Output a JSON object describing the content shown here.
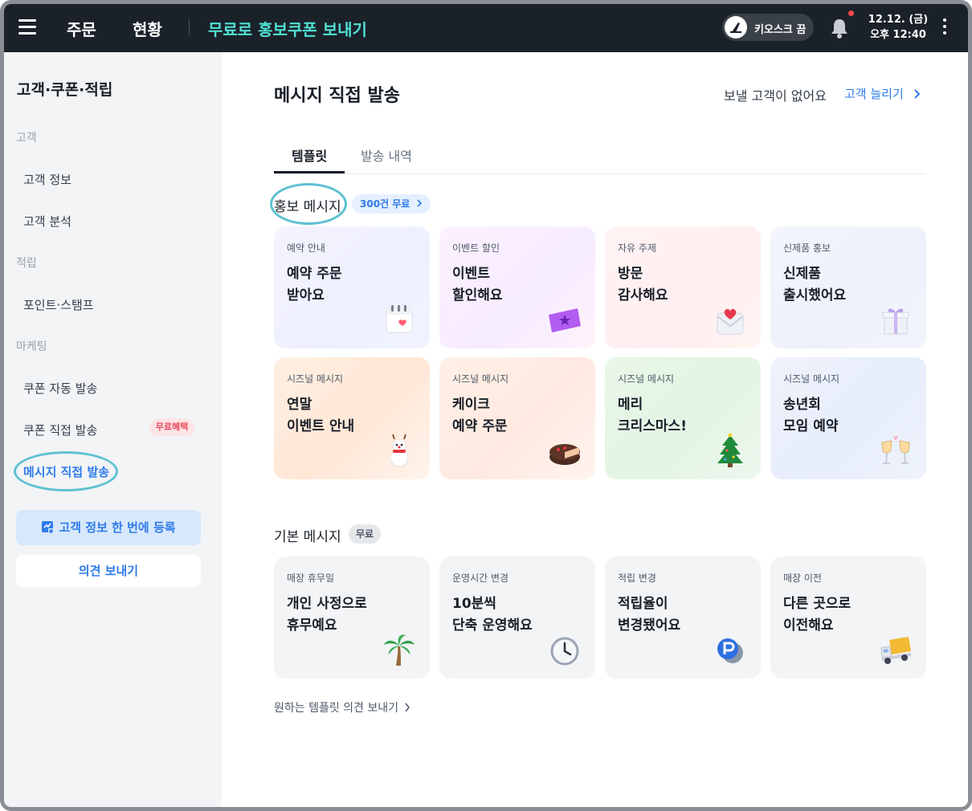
{
  "topbar": {
    "nav": [
      "주문",
      "현황"
    ],
    "promo_link": "무료로 홍보쿠폰 보내기",
    "kiosk_label": "키오스크 끔",
    "date": "12.12. (금)",
    "time": "오후 12:40",
    "accent_color": "#4fe0d4"
  },
  "sidebar": {
    "title": "고객·쿠폰·적립",
    "sections": [
      {
        "label": "고객",
        "items": [
          "고객 정보",
          "고객 분석"
        ]
      },
      {
        "label": "적립",
        "items": [
          "포인트·스탬프"
        ]
      },
      {
        "label": "마케팅",
        "items": [
          "쿠폰 자동 발송",
          "쿠폰 직접 발송",
          "메시지 직접 발송"
        ]
      }
    ],
    "coupon_badge": "무료혜택",
    "active_item": "메시지 직접 발송",
    "register_button": "고객 정보 한 번에 등록",
    "feedback_button": "의견 보내기"
  },
  "main": {
    "title": "메시지 직접 발송",
    "no_customer_text": "보낼 고객이 없어요",
    "grow_link": "고객 늘리기",
    "tabs": [
      "템플릿",
      "발송 내역"
    ],
    "promo_section": {
      "title": "홍보 메시지",
      "chip": "300건 무료",
      "cards": [
        {
          "category": "예약 안내",
          "line1": "예약 주문",
          "line2": "받아요",
          "icon": "calendar-heart-icon"
        },
        {
          "category": "이벤트 할인",
          "line1": "이벤트",
          "line2": "할인해요",
          "icon": "ticket-icon"
        },
        {
          "category": "자유 주제",
          "line1": "방문",
          "line2": "감사해요",
          "icon": "love-letter-icon"
        },
        {
          "category": "신제품 홍보",
          "line1": "신제품",
          "line2": "출시했어요",
          "icon": "gift-box-icon"
        },
        {
          "category": "시즈널 메시지",
          "line1": "연말",
          "line2": "이벤트 안내",
          "icon": "snowman-icon"
        },
        {
          "category": "시즈널 메시지",
          "line1": "케이크",
          "line2": "예약 주문",
          "icon": "cake-icon"
        },
        {
          "category": "시즈널 메시지",
          "line1": "메리",
          "line2": "크리스마스!",
          "icon": "christmas-tree-icon"
        },
        {
          "category": "시즈널 메시지",
          "line1": "송년회",
          "line2": "모임 예약",
          "icon": "champagne-glasses-icon"
        }
      ]
    },
    "basic_section": {
      "title": "기본 메시지",
      "chip": "무료",
      "cards": [
        {
          "category": "매장 휴무일",
          "line1": "개인 사정으로",
          "line2": "휴무예요",
          "icon": "palm-tree-icon"
        },
        {
          "category": "운영시간 변경",
          "line1": "10분씩",
          "line2": "단축 운영해요",
          "icon": "clock-icon"
        },
        {
          "category": "적립 변경",
          "line1": "적립율이",
          "line2": "변경됐어요",
          "icon": "point-coin-icon"
        },
        {
          "category": "매장 이전",
          "line1": "다른 곳으로",
          "line2": "이전해요",
          "icon": "truck-icon"
        }
      ]
    },
    "feedback_link": "원하는 템플릿 의견 보내기"
  }
}
